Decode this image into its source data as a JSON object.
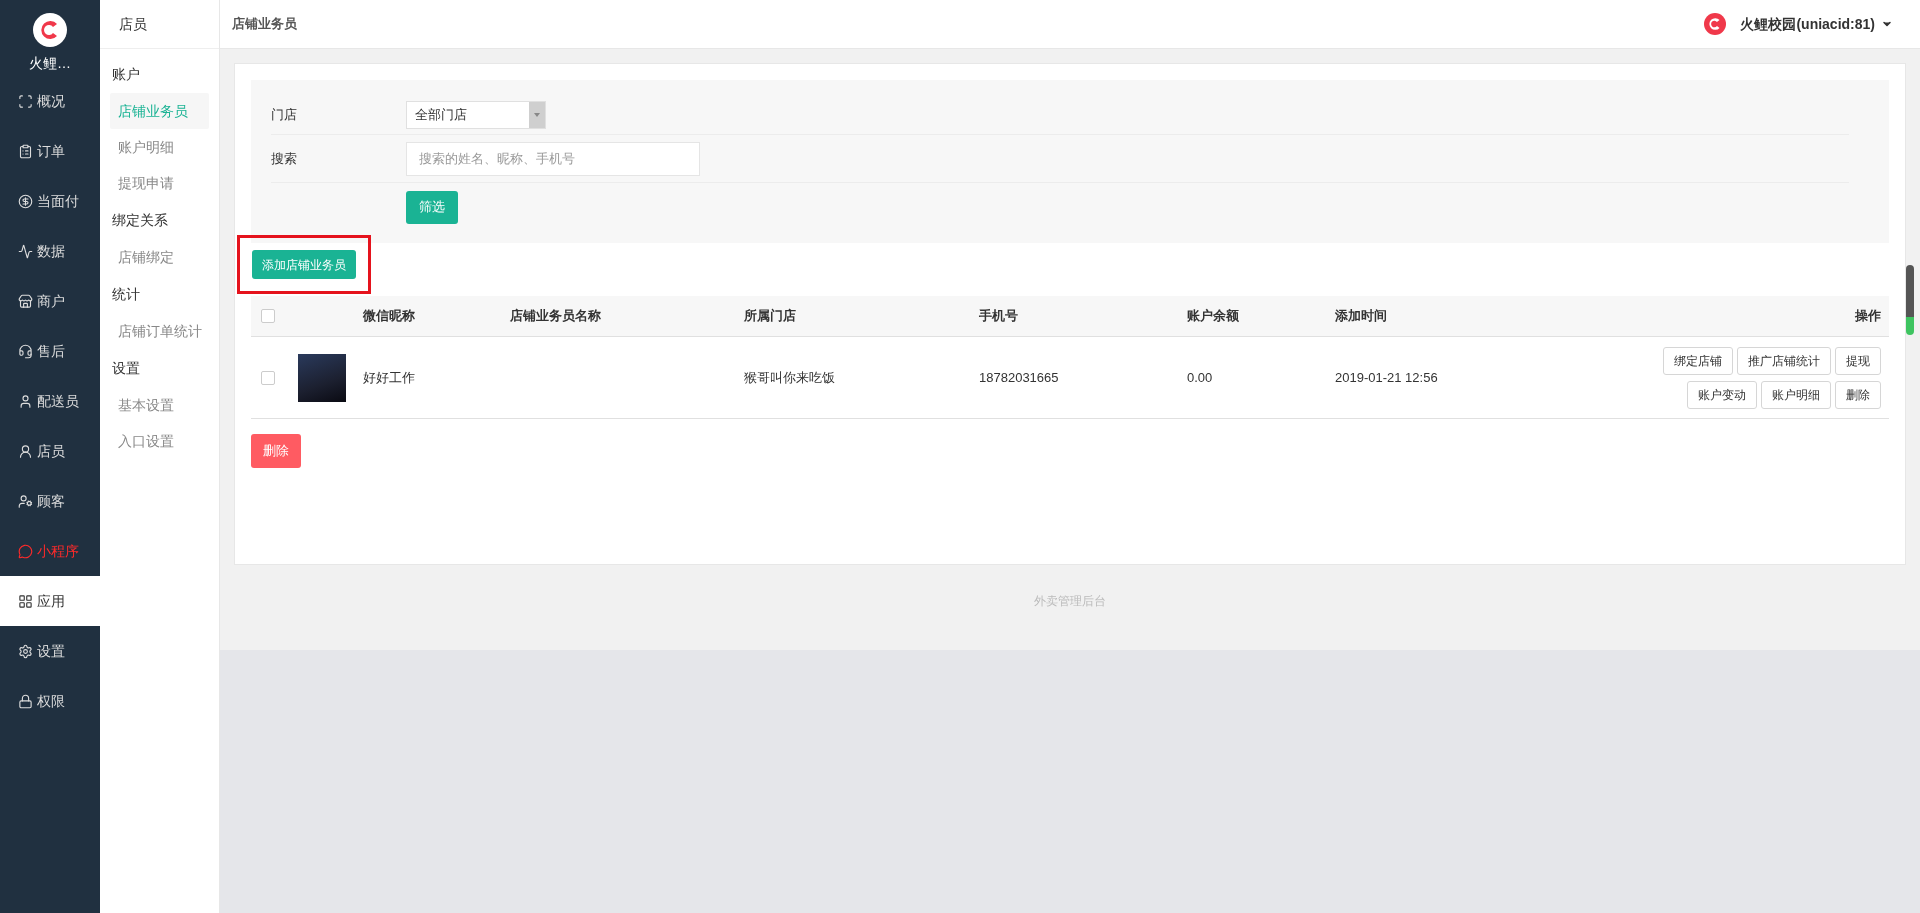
{
  "brand": {
    "name": "火鲤…"
  },
  "nav": [
    {
      "label": "概况",
      "selected": false,
      "kind": "normal"
    },
    {
      "label": "订单",
      "selected": false,
      "kind": "normal"
    },
    {
      "label": "当面付",
      "selected": false,
      "kind": "normal"
    },
    {
      "label": "数据",
      "selected": false,
      "kind": "normal"
    },
    {
      "label": "商户",
      "selected": false,
      "kind": "normal"
    },
    {
      "label": "售后",
      "selected": false,
      "kind": "normal"
    },
    {
      "label": "配送员",
      "selected": false,
      "kind": "normal"
    },
    {
      "label": "店员",
      "selected": false,
      "kind": "normal"
    },
    {
      "label": "顾客",
      "selected": false,
      "kind": "normal"
    },
    {
      "label": "小程序",
      "selected": false,
      "kind": "promo"
    },
    {
      "label": "应用",
      "selected": true,
      "kind": "normal"
    },
    {
      "label": "设置",
      "selected": false,
      "kind": "normal"
    },
    {
      "label": "权限",
      "selected": false,
      "kind": "normal"
    }
  ],
  "subnav": {
    "title": "店员",
    "groups": [
      {
        "heading": "账户",
        "items": [
          {
            "label": "店铺业务员",
            "selected": true
          },
          {
            "label": "账户明细",
            "selected": false
          },
          {
            "label": "提现申请",
            "selected": false
          }
        ]
      },
      {
        "heading": "绑定关系",
        "items": [
          {
            "label": "店铺绑定",
            "selected": false
          }
        ]
      },
      {
        "heading": "统计",
        "items": [
          {
            "label": "店铺订单统计",
            "selected": false
          }
        ]
      },
      {
        "heading": "设置",
        "items": [
          {
            "label": "基本设置",
            "selected": false
          },
          {
            "label": "入口设置",
            "selected": false
          }
        ]
      }
    ]
  },
  "header": {
    "title": "店铺业务员",
    "account": "火鲤校园(uniacid:81)"
  },
  "filter": {
    "store_label": "门店",
    "store_value": "全部门店",
    "search_label": "搜索",
    "search_placeholder": "搜索的姓名、昵称、手机号",
    "submit": "筛选"
  },
  "add_button": {
    "label": "添加店铺业务员",
    "highlighted": true
  },
  "table": {
    "all_checked": false,
    "columns": [
      "微信昵称",
      "店铺业务员名称",
      "所属门店",
      "手机号",
      "账户余额",
      "添加时间",
      "操作"
    ],
    "rows": [
      {
        "checked": false,
        "nickname": "好好工作",
        "store": "猴哥叫你来吃饭",
        "phone": "18782031665",
        "balance": "0.00",
        "time": "2019-01-21 12:56",
        "actions": [
          [
            "绑定店铺",
            "推广店铺统计",
            "提现"
          ],
          [
            "账户变动",
            "账户明细",
            "删除"
          ]
        ]
      }
    ]
  },
  "bulk_delete": "删除",
  "footer": "外卖管理后台"
}
